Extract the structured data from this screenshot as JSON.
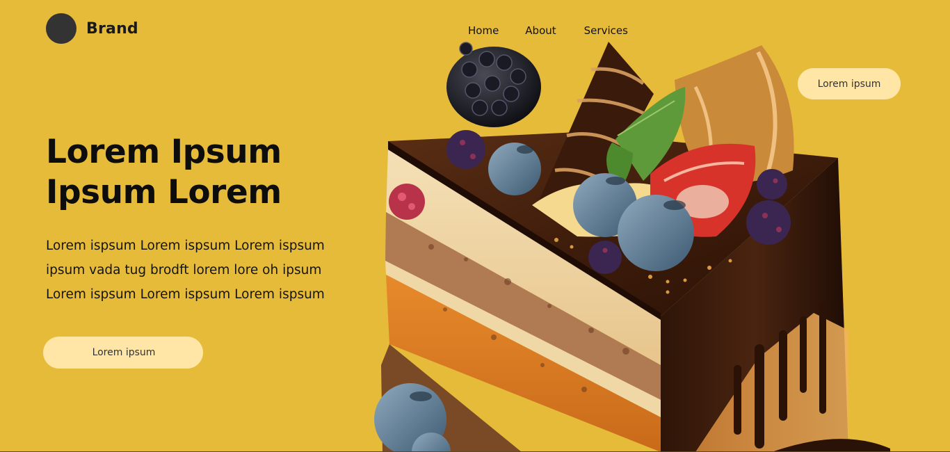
{
  "brand": {
    "name": "Brand"
  },
  "nav": {
    "items": [
      {
        "label": "Home"
      },
      {
        "label": "About"
      },
      {
        "label": "Services"
      }
    ]
  },
  "top_button": {
    "label": "Lorem ipsum"
  },
  "hero": {
    "title": "Lorem Ipsum Ipsum Lorem",
    "lines": [
      "Lorem ispsum  Lorem ispsum  Lorem ispsum",
      "ipsum vada tug brodft lorem lore oh ipsum",
      "Lorem ispsum  Lorem ispsum  Lorem ispsum"
    ],
    "cta_label": "Lorem ipsum"
  },
  "colors": {
    "background": "#E7BB3A",
    "button": "#FFE6A6",
    "logo": "#333333"
  }
}
